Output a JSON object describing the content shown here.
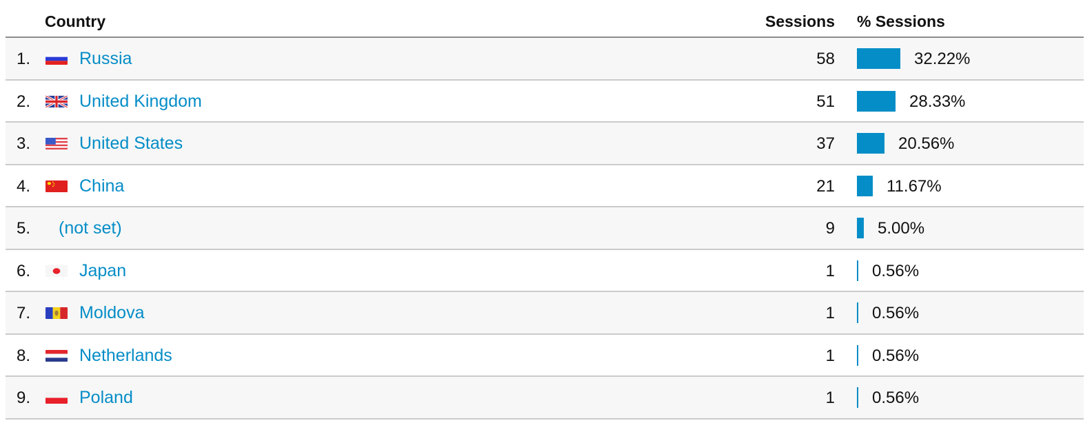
{
  "table": {
    "headers": {
      "country": "Country",
      "sessions": "Sessions",
      "pct_sessions": "% Sessions"
    },
    "bar_color": "#058dc7",
    "rows": [
      {
        "rank": "1.",
        "country": "Russia",
        "flag": "russia-flag",
        "sessions": "58",
        "pct": "32.22%",
        "pct_value": 32.22
      },
      {
        "rank": "2.",
        "country": "United Kingdom",
        "flag": "uk-flag",
        "sessions": "51",
        "pct": "28.33%",
        "pct_value": 28.33
      },
      {
        "rank": "3.",
        "country": "United States",
        "flag": "us-flag",
        "sessions": "37",
        "pct": "20.56%",
        "pct_value": 20.56
      },
      {
        "rank": "4.",
        "country": "China",
        "flag": "china-flag",
        "sessions": "21",
        "pct": "11.67%",
        "pct_value": 11.67
      },
      {
        "rank": "5.",
        "country": "(not set)",
        "flag": null,
        "sessions": "9",
        "pct": "5.00%",
        "pct_value": 5.0
      },
      {
        "rank": "6.",
        "country": "Japan",
        "flag": "japan-flag",
        "sessions": "1",
        "pct": "0.56%",
        "pct_value": 0.56
      },
      {
        "rank": "7.",
        "country": "Moldova",
        "flag": "moldova-flag",
        "sessions": "1",
        "pct": "0.56%",
        "pct_value": 0.56
      },
      {
        "rank": "8.",
        "country": "Netherlands",
        "flag": "netherlands-flag",
        "sessions": "1",
        "pct": "0.56%",
        "pct_value": 0.56
      },
      {
        "rank": "9.",
        "country": "Poland",
        "flag": "poland-flag",
        "sessions": "1",
        "pct": "0.56%",
        "pct_value": 0.56
      }
    ]
  }
}
